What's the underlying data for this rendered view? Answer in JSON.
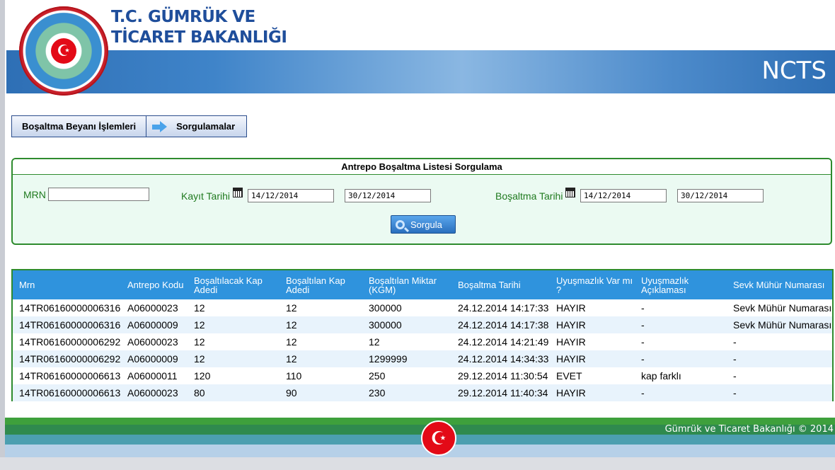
{
  "header": {
    "ministry_line1": "T.C. GÜMRÜK VE",
    "ministry_line2": "TİCARET BAKANLIĞI",
    "app_name": "NCTS",
    "logo_icon": "crescent-star-emblem"
  },
  "nav": {
    "item1": "Boşaltma Beyanı İşlemleri",
    "item2": "Sorgulamalar",
    "item2_icon": "arrow-right-icon"
  },
  "query": {
    "title": "Antrepo Boşaltma Listesi Sorgulama",
    "mrn_label": "MRN",
    "mrn_value": "",
    "kayit_label": "Kayıt Tarihi",
    "kayit_from": "14/12/2014",
    "kayit_to": "30/12/2014",
    "bosaltma_label": "Boşaltma Tarihi",
    "bosaltma_from": "14/12/2014",
    "bosaltma_to": "30/12/2014",
    "search_label": "Sorgula"
  },
  "table": {
    "columns": [
      "Mrn",
      "Antrepo Kodu",
      "Boşaltılacak Kap Adedi",
      "Boşaltılan Kap Adedi",
      "Boşaltılan Miktar (KGM)",
      "Boşaltma Tarihi",
      "Uyuşmazlık Var mı ?",
      "Uyuşmazlık Açıklaması",
      "Sevk Mühür Numarası"
    ],
    "rows": [
      [
        "14TR06160000006316",
        "A06000023",
        "12",
        "12",
        "300000",
        "24.12.2014 14:17:33",
        "HAYIR",
        "-",
        "Sevk Mühür Numarası"
      ],
      [
        "14TR06160000006316",
        "A06000009",
        "12",
        "12",
        "300000",
        "24.12.2014 14:17:38",
        "HAYIR",
        "-",
        "Sevk Mühür Numarası"
      ],
      [
        "14TR06160000006292",
        "A06000023",
        "12",
        "12",
        "12",
        "24.12.2014 14:21:49",
        "HAYIR",
        "-",
        "-"
      ],
      [
        "14TR06160000006292",
        "A06000009",
        "12",
        "12",
        "1299999",
        "24.12.2014 14:34:33",
        "HAYIR",
        "-",
        "-"
      ],
      [
        "14TR06160000006613",
        "A06000011",
        "120",
        "110",
        "250",
        "29.12.2014 11:30:54",
        "EVET",
        "kap farklı",
        "-"
      ],
      [
        "14TR06160000006613",
        "A06000023",
        "80",
        "90",
        "230",
        "29.12.2014 11:40:34",
        "HAYIR",
        "-",
        "-"
      ]
    ]
  },
  "footer": {
    "copyright": "Gümrük ve Ticaret Bakanlığı © 2014",
    "flag_icon": "turkish-flag-emblem"
  },
  "colors": {
    "header_blue": "#3f84c9",
    "table_header": "#2f93dd",
    "panel_border": "#2e8b2e",
    "panel_bg": "#ebfaf2",
    "label_green": "#1f7a1f"
  }
}
